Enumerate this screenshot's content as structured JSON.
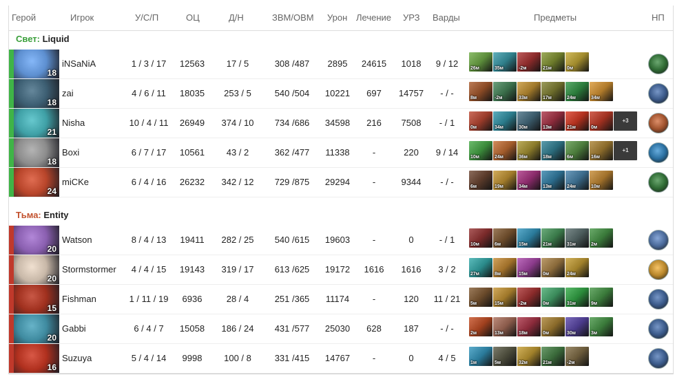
{
  "headers": {
    "hero": "Герой",
    "player": "Игрок",
    "kda": "У/С/П",
    "nw": "ОЦ",
    "lhdn": "Д/Н",
    "gpmxpm": "ЗВМ/ОВМ",
    "damage": "Урон",
    "heal": "Лечение",
    "building": "УРЗ",
    "wards": "Варды",
    "items": "Предметы",
    "np": "НП"
  },
  "light": {
    "side_label": "Свет:",
    "team_name": "Liquid",
    "players": [
      {
        "level": "18",
        "name": "iNSaNiA",
        "kda": "1 / 3 / 17",
        "nw": "12563",
        "lhdn": "17 / 5",
        "gpmxpm": "308 /487",
        "damage": "2895",
        "heal": "24615",
        "building": "1018",
        "wards": "9 / 12",
        "hero_color": "#5d8fd0",
        "np_color": "#2f6b34",
        "items": [
          {
            "t": "26м",
            "c": "#5b8c3a"
          },
          {
            "t": "35м",
            "c": "#2f7e8a"
          },
          {
            "t": "-2м",
            "c": "#8b2a2a"
          },
          {
            "t": "21м",
            "c": "#6c7a2a"
          },
          {
            "t": "0м",
            "c": "#a08a2c"
          }
        ]
      },
      {
        "level": "18",
        "name": "zai",
        "kda": "4 / 6 / 11",
        "nw": "18035",
        "lhdn": "253 / 5",
        "gpmxpm": "540 /504",
        "damage": "10221",
        "heal": "697",
        "building": "14757",
        "wards": "- / -",
        "hero_color": "#3d5f73",
        "np_color": "#3b5a8a",
        "items": [
          {
            "t": "8м",
            "c": "#8a4a25"
          },
          {
            "t": "-2м",
            "c": "#3a6e4a"
          },
          {
            "t": "33м",
            "c": "#a0782a"
          },
          {
            "t": "17м",
            "c": "#6a6a2a"
          },
          {
            "t": "24м",
            "c": "#2a7a3a"
          },
          {
            "t": "34м",
            "c": "#b07a2a"
          }
        ]
      },
      {
        "level": "21",
        "name": "Nisha",
        "kda": "10 / 4 / 11",
        "nw": "26949",
        "lhdn": "374 / 10",
        "gpmxpm": "734 /686",
        "damage": "34598",
        "heal": "216",
        "building": "7508",
        "wards": "- / 1",
        "hero_color": "#3fa0a6",
        "np_color": "#a0522d",
        "items": [
          {
            "t": "0м",
            "c": "#9a3b2a"
          },
          {
            "t": "34м",
            "c": "#2a7a8a"
          },
          {
            "t": "30м",
            "c": "#3a5a6a"
          },
          {
            "t": "13м",
            "c": "#8a2a3a"
          },
          {
            "t": "21м",
            "c": "#b0301e"
          },
          {
            "t": "0м",
            "c": "#a03020"
          },
          {
            "t": "+3",
            "c": "#3a3a3a",
            "more": true
          }
        ]
      },
      {
        "level": "18",
        "name": "Boxi",
        "kda": "6 / 7 / 17",
        "nw": "10561",
        "lhdn": "43 / 2",
        "gpmxpm": "362 /477",
        "damage": "11338",
        "heal": "-",
        "building": "220",
        "wards": "9 / 14",
        "hero_color": "#8c8c8c",
        "np_color": "#2a6fa0",
        "items": [
          {
            "t": "10м",
            "c": "#3a8a3a"
          },
          {
            "t": "24м",
            "c": "#a05a2a"
          },
          {
            "t": "36м",
            "c": "#8a7a2a"
          },
          {
            "t": "18м",
            "c": "#2a6a7a"
          },
          {
            "t": "6м",
            "c": "#4a7a3a"
          },
          {
            "t": "16м",
            "c": "#8a6a2a"
          },
          {
            "t": "+1",
            "c": "#3a3a3a",
            "more": true
          }
        ]
      },
      {
        "level": "24",
        "name": "miCKe",
        "kda": "6 / 4 / 16",
        "nw": "26232",
        "lhdn": "342 / 12",
        "gpmxpm": "729 /875",
        "damage": "29294",
        "heal": "-",
        "building": "9344",
        "wards": "- / -",
        "hero_color": "#b8452a",
        "np_color": "#2f6b34",
        "items": [
          {
            "t": "6м",
            "c": "#5a3a2a"
          },
          {
            "t": "19м",
            "c": "#a07a2a"
          },
          {
            "t": "34м",
            "c": "#8a2a6a"
          },
          {
            "t": "13м",
            "c": "#2a6a8a"
          },
          {
            "t": "24м",
            "c": "#3a6a8a"
          },
          {
            "t": "10м",
            "c": "#a0702a"
          }
        ]
      }
    ]
  },
  "dark": {
    "side_label": "Тьма:",
    "team_name": "Entity",
    "players": [
      {
        "level": "20",
        "name": "Watson",
        "kda": "8 / 4 / 13",
        "nw": "19411",
        "lhdn": "282 / 25",
        "gpmxpm": "540 /615",
        "damage": "19603",
        "heal": "-",
        "building": "0",
        "wards": "- / 1",
        "hero_color": "#8a5fb0",
        "np_color": "#4a6a9a",
        "items": [
          {
            "t": "10м",
            "c": "#7a2a2a"
          },
          {
            "t": "6м",
            "c": "#6a4a2a"
          },
          {
            "t": "15м",
            "c": "#2a7a9a"
          },
          {
            "t": "21м",
            "c": "#3a7a4a"
          },
          {
            "t": "31м",
            "c": "#4a5a5a"
          },
          {
            "t": "2м",
            "c": "#3a7a3a"
          }
        ]
      },
      {
        "level": "20",
        "name": "Stormstormer",
        "kda": "4 / 4 / 15",
        "nw": "19143",
        "lhdn": "319 / 17",
        "gpmxpm": "613 /625",
        "damage": "19172",
        "heal": "1616",
        "building": "1616",
        "wards": "3 / 2",
        "hero_color": "#c8b8a8",
        "np_color": "#b8862a",
        "items": [
          {
            "t": "27м",
            "c": "#2a8a8a"
          },
          {
            "t": "8м",
            "c": "#a0702a"
          },
          {
            "t": "15м",
            "c": "#8a3a8a"
          },
          {
            "t": "0м",
            "c": "#8a6a3a"
          },
          {
            "t": "24м",
            "c": "#a0802a"
          }
        ]
      },
      {
        "level": "15",
        "name": "Fishman",
        "kda": "1 / 11 / 19",
        "nw": "6936",
        "lhdn": "28 / 4",
        "gpmxpm": "251 /365",
        "damage": "11174",
        "heal": "-",
        "building": "120",
        "wards": "11 / 21",
        "hero_color": "#a0301e",
        "np_color": "#3a5a8a",
        "items": [
          {
            "t": "5м",
            "c": "#6a4a2a"
          },
          {
            "t": "15м",
            "c": "#a0782a"
          },
          {
            "t": "-2м",
            "c": "#8a2a2a"
          },
          {
            "t": "0м",
            "c": "#3a8a5a"
          },
          {
            "t": "31м",
            "c": "#2a8a3a"
          },
          {
            "t": "9м",
            "c": "#3a7a3a"
          }
        ]
      },
      {
        "level": "20",
        "name": "Gabbi",
        "kda": "6 / 4 / 7",
        "nw": "15058",
        "lhdn": "186 / 24",
        "gpmxpm": "431 /577",
        "damage": "25030",
        "heal": "628",
        "building": "187",
        "wards": "- / -",
        "hero_color": "#3f8ba0",
        "np_color": "#3a5a8a",
        "items": [
          {
            "t": "2м",
            "c": "#a0401e"
          },
          {
            "t": "13м",
            "c": "#8a5a4a"
          },
          {
            "t": "18м",
            "c": "#8a2a3a"
          },
          {
            "t": "0м",
            "c": "#8a6a2a"
          },
          {
            "t": "30м",
            "c": "#4a3a8a"
          },
          {
            "t": "3м",
            "c": "#3a7a3a"
          }
        ]
      },
      {
        "level": "16",
        "name": "Suzuya",
        "kda": "5 / 4 / 14",
        "nw": "9998",
        "lhdn": "100 / 8",
        "gpmxpm": "331 /415",
        "damage": "14767",
        "heal": "-",
        "building": "0",
        "wards": "4 / 5",
        "hero_color": "#b0301e",
        "np_color": "#3a5a8a",
        "items": [
          {
            "t": "1м",
            "c": "#2a7a9a"
          },
          {
            "t": "5м",
            "c": "#4a4a3a"
          },
          {
            "t": "32м",
            "c": "#a0802a"
          },
          {
            "t": "21м",
            "c": "#3a6a3a"
          },
          {
            "t": "-2м",
            "c": "#6a5a3a"
          }
        ]
      }
    ]
  }
}
